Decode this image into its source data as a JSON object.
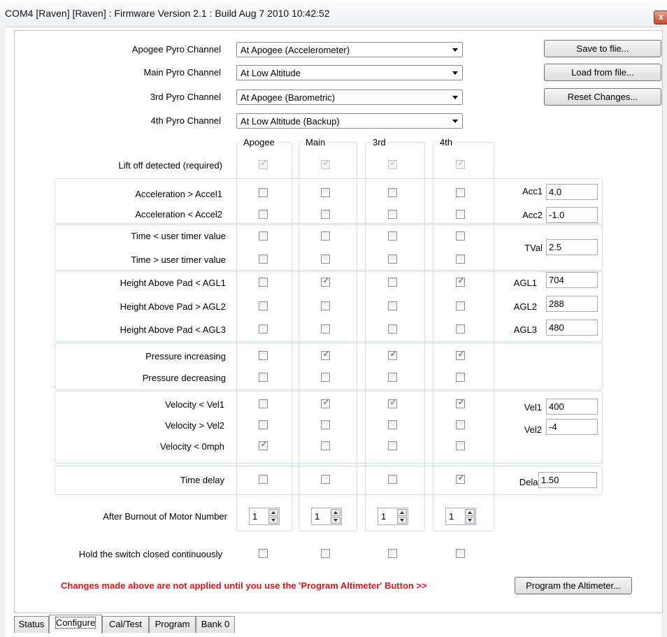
{
  "window": {
    "title": "COM4 [Raven] [Raven] : Firmware Version 2.1 : Build Aug  7 2010 10:42:52",
    "close_glyph": "x"
  },
  "pyro_channels": [
    {
      "label": "Apogee Pyro Channel",
      "value": "At Apogee (Accelerometer)"
    },
    {
      "label": "Main Pyro Channel",
      "value": "At Low Altitude"
    },
    {
      "label": "3rd Pyro Channel",
      "value": "At Apogee (Barometric)"
    },
    {
      "label": "4th Pyro Channel",
      "value": "At Low Altitude (Backup)"
    }
  ],
  "buttons": {
    "save": "Save to flie...",
    "load": "Load from file...",
    "reset": "Reset Changes...",
    "program": "Program the Altimeter..."
  },
  "columns": [
    "Apogee",
    "Main",
    "3rd",
    "4th"
  ],
  "rows": [
    {
      "label": "Lift off detected (required)",
      "checks": [
        true,
        true,
        true,
        true
      ],
      "disabled": true
    },
    {
      "label": "Acceleration > Accel1",
      "checks": [
        false,
        false,
        false,
        false
      ]
    },
    {
      "label": "Acceleration < Accel2",
      "checks": [
        false,
        false,
        false,
        false
      ]
    },
    {
      "label": "Time < user timer value",
      "checks": [
        false,
        false,
        false,
        false
      ]
    },
    {
      "label": "Time > user timer value",
      "checks": [
        false,
        false,
        false,
        false
      ]
    },
    {
      "label": "Height Above Pad < AGL1",
      "checks": [
        false,
        true,
        false,
        true
      ]
    },
    {
      "label": "Height Above Pad > AGL2",
      "checks": [
        false,
        false,
        false,
        false
      ]
    },
    {
      "label": "Height Above Pad < AGL3",
      "checks": [
        false,
        false,
        false,
        false
      ]
    },
    {
      "label": "Pressure increasing",
      "checks": [
        false,
        true,
        true,
        true
      ]
    },
    {
      "label": "Pressure decreasing",
      "checks": [
        false,
        false,
        false,
        false
      ]
    },
    {
      "label": "Velocity < Vel1",
      "checks": [
        false,
        true,
        true,
        true
      ]
    },
    {
      "label": "Velocity > Vel2",
      "checks": [
        false,
        false,
        false,
        false
      ]
    },
    {
      "label": "Velocity < 0mph",
      "checks": [
        true,
        false,
        false,
        false
      ]
    },
    {
      "label": "Time delay",
      "checks": [
        false,
        false,
        false,
        true
      ]
    },
    {
      "label": "Hold the switch closed continuously",
      "checks": [
        false,
        false,
        false,
        false
      ]
    }
  ],
  "burnout": {
    "label": "After Burnout of Motor Number",
    "values": [
      "1",
      "1",
      "1",
      "1"
    ]
  },
  "params": [
    {
      "label": "Acc1",
      "value": "4.0"
    },
    {
      "label": "Acc2",
      "value": "-1.0"
    },
    {
      "label": "TVal",
      "value": "2.5"
    },
    {
      "label": "AGL1",
      "value": "704"
    },
    {
      "label": "AGL2",
      "value": "288"
    },
    {
      "label": "AGL3",
      "value": "480"
    },
    {
      "label": "Vel1",
      "value": "400"
    },
    {
      "label": "Vel2",
      "value": "-4"
    },
    {
      "label": "Delay",
      "value": "1.50"
    }
  ],
  "warning": "Changes made above are not applied until you use the 'Program Altimeter' Button >>",
  "tabs": [
    {
      "label": "Status",
      "active": false
    },
    {
      "label": "Configure",
      "active": true
    },
    {
      "label": "Cal/Test",
      "active": false
    },
    {
      "label": "Program",
      "active": false
    },
    {
      "label": "Bank 0",
      "active": false
    }
  ],
  "colors": {
    "warning": "#e0141e",
    "check": "#3f5f8f"
  },
  "check_glyph": "✓"
}
